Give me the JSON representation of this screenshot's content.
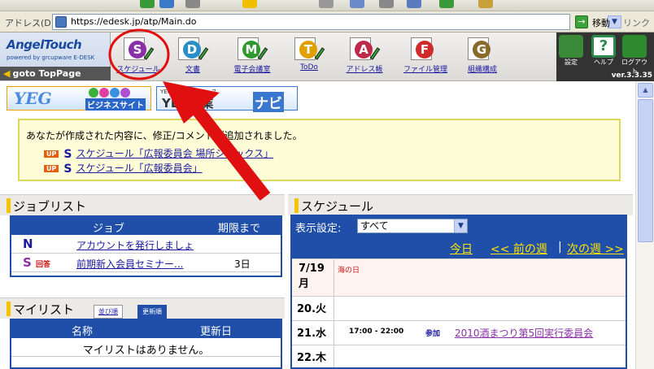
{
  "browser": {
    "address_label": "アドレス(D)",
    "url": "https://edesk.jp/atp/Main.do",
    "go_label": "移動",
    "links_label": "リンク"
  },
  "header": {
    "brand": "AngelTouch",
    "tagline": "powered by grcupware E-DESK",
    "goto_label": "goto TopPage",
    "nav": [
      {
        "label": "スケジュール",
        "letter": "S",
        "color": "#8a2fa8"
      },
      {
        "label": "文書",
        "letter": "D",
        "color": "#2a8fc8"
      },
      {
        "label": "電子会議室",
        "letter": "M",
        "color": "#2e9a2e"
      },
      {
        "label": "ToDo",
        "letter": "T",
        "color": "#e0a000"
      },
      {
        "label": "アドレス帳",
        "letter": "A",
        "color": "#c02a4a"
      },
      {
        "label": "ファイル管理",
        "letter": "F",
        "color": "#d02a2a"
      },
      {
        "label": "組織構成",
        "letter": "G",
        "color": "#8a6a2a"
      }
    ],
    "sys": [
      {
        "label": "設定",
        "icon": "gear-icon",
        "color": "#3a8a3a"
      },
      {
        "label": "ヘルプ",
        "icon": "help-icon",
        "color": "#2a8a4a"
      },
      {
        "label": "ログアウト",
        "icon": "exit-icon",
        "color": "#2e8a2e"
      }
    ],
    "version": "ver.3.3.35"
  },
  "banners": {
    "yeg": "YEG",
    "yeg_sub": "ビジネスサイト",
    "navi_small": "YEG企業データベース",
    "navi_big": "YEG事業",
    "navi_tag": "ナビ"
  },
  "notice": {
    "message": "あなたが作成された内容に、修正/コメントが追加されました。",
    "items": [
      {
        "badge": "UP",
        "text": "スケジュール「広報委員会 場所シダックス」"
      },
      {
        "badge": "UP",
        "text": "スケジュール「広報委員会」"
      }
    ]
  },
  "joblist": {
    "title": "ジョブリスト",
    "col_job": "ジョブ",
    "col_due": "期限まで",
    "rows": [
      {
        "icon": "N",
        "tag": "",
        "text": "アカウントを発行しましょ",
        "due": ""
      },
      {
        "icon": "S",
        "tag": "回答",
        "text": "前期新入会員セミナー...",
        "due": "3日"
      }
    ]
  },
  "mylist": {
    "title": "マイリスト",
    "tab_order": "並び順",
    "tab_updated": "更新順",
    "col_name": "名称",
    "col_updated": "更新日",
    "empty": "マイリストはありません。"
  },
  "schedule": {
    "title": "スケジュール",
    "display_label": "表示設定:",
    "display_value": "すべて",
    "today": "今日",
    "prev_week": "<< 前の週",
    "sep": "|",
    "next_week": "次の週 >>",
    "days": [
      {
        "label": "7/19月",
        "note": "海の日",
        "time": "",
        "tag": "",
        "event": ""
      },
      {
        "label": "20.火",
        "note": "",
        "time": "",
        "tag": "",
        "event": ""
      },
      {
        "label": "21.水",
        "note": "",
        "time": "17:00 - 22:00",
        "tag": "参加",
        "event": "2010酒まつり第5回実行委員会"
      },
      {
        "label": "22.木",
        "note": "",
        "time": "",
        "tag": "",
        "event": ""
      }
    ]
  },
  "colors": {
    "accent_blue": "#1f4fa8",
    "highlight_yellow": "#ffe400",
    "annotation_red": "#e01010"
  }
}
